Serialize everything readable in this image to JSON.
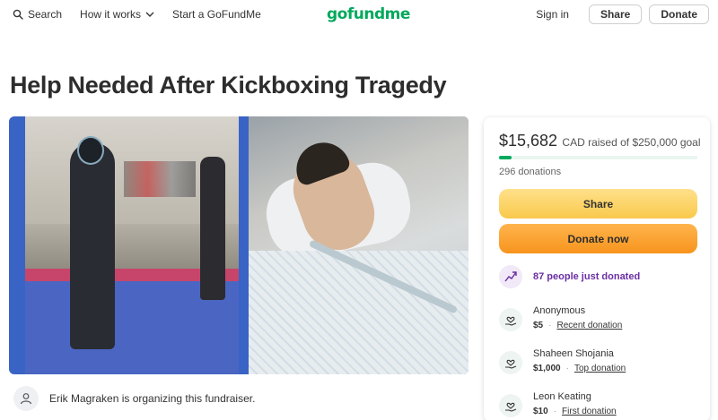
{
  "header": {
    "search_label": "Search",
    "how_it_works_label": "How it works",
    "start_label": "Start a GoFundMe",
    "logo_text": "gofundme",
    "signin_label": "Sign in",
    "share_label": "Share",
    "donate_label": "Donate"
  },
  "campaign": {
    "title": "Help Needed After Kickboxing Tragedy",
    "organizer_text": "Erik Magraken is organizing this fundraiser."
  },
  "donation": {
    "raised_amount": "$15,682",
    "raised_suffix": "CAD raised of $250,000 goal",
    "progress_fraction": 0.0627,
    "donations_count": "296 donations",
    "share_button": "Share",
    "donate_button": "Donate now",
    "recent_activity": "87 people just donated",
    "donors": [
      {
        "name": "Anonymous",
        "amount": "$5",
        "tag": "Recent donation"
      },
      {
        "name": "Shaheen Shojania",
        "amount": "$1,000",
        "tag": "Top donation"
      },
      {
        "name": "Leon Keating",
        "amount": "$10",
        "tag": "First donation"
      }
    ]
  },
  "colors": {
    "brand_green": "#02a95c",
    "share_yellow": "#f9c94c",
    "donate_orange": "#f7941d",
    "activity_purple": "#6b2ea3"
  },
  "icons": {
    "search": "search-icon",
    "chevron": "chevron-down-icon",
    "organizer": "user-icon",
    "recent": "trending-up-icon",
    "donor": "heart-hand-icon"
  }
}
